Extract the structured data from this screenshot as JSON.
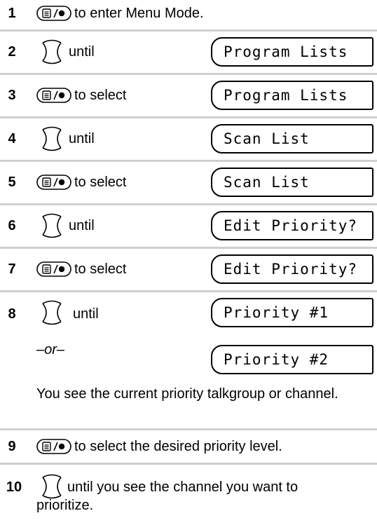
{
  "steps": [
    {
      "num": "1",
      "text": "to enter Menu Mode."
    },
    {
      "num": "2",
      "text": "until",
      "display": "Program Lists"
    },
    {
      "num": "3",
      "text": "to select",
      "display": "Program Lists"
    },
    {
      "num": "4",
      "text": "until",
      "display": "Scan List"
    },
    {
      "num": "5",
      "text": "to select",
      "display": "Scan List"
    },
    {
      "num": "6",
      "text": "until",
      "display": "Edit Priority?"
    },
    {
      "num": "7",
      "text": "to select",
      "display": "Edit Priority?"
    },
    {
      "num": "8",
      "text": "until",
      "display": "Priority #1"
    },
    {
      "num": "9",
      "text": "to select the desired priority level."
    },
    {
      "num": "10",
      "text_line1": "until you see the channel you want to",
      "text_line2": "prioritize."
    }
  ],
  "alt": {
    "or_label": "–or–",
    "display": "Priority #2"
  },
  "note": "You see the current priority talkgroup or channel.",
  "icons": {
    "menu_select": "menu-select-button-icon",
    "navigate": "navigate-knob-icon"
  }
}
